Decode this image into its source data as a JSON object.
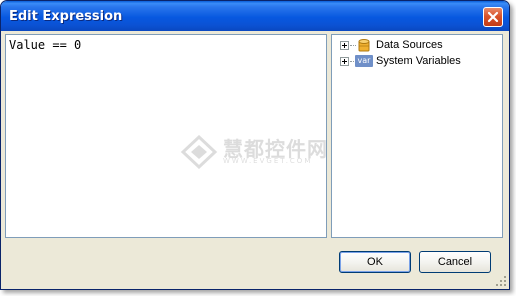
{
  "window": {
    "title": "Edit Expression"
  },
  "editor": {
    "text": "Value == 0"
  },
  "tree": {
    "nodes": [
      {
        "label": "Data Sources",
        "icon": "database-icon"
      },
      {
        "label": "System Variables",
        "icon": "var-icon",
        "badge": "var"
      }
    ]
  },
  "watermark": {
    "text": "慧都控件网",
    "sub": "WWW.EVGET.COM"
  },
  "buttons": {
    "ok": "OK",
    "cancel": "Cancel"
  },
  "colors": {
    "titlebar": "#0758e0",
    "close": "#d9532b",
    "dialog_bg": "#ece9d8",
    "field_border": "#7f9db9"
  }
}
